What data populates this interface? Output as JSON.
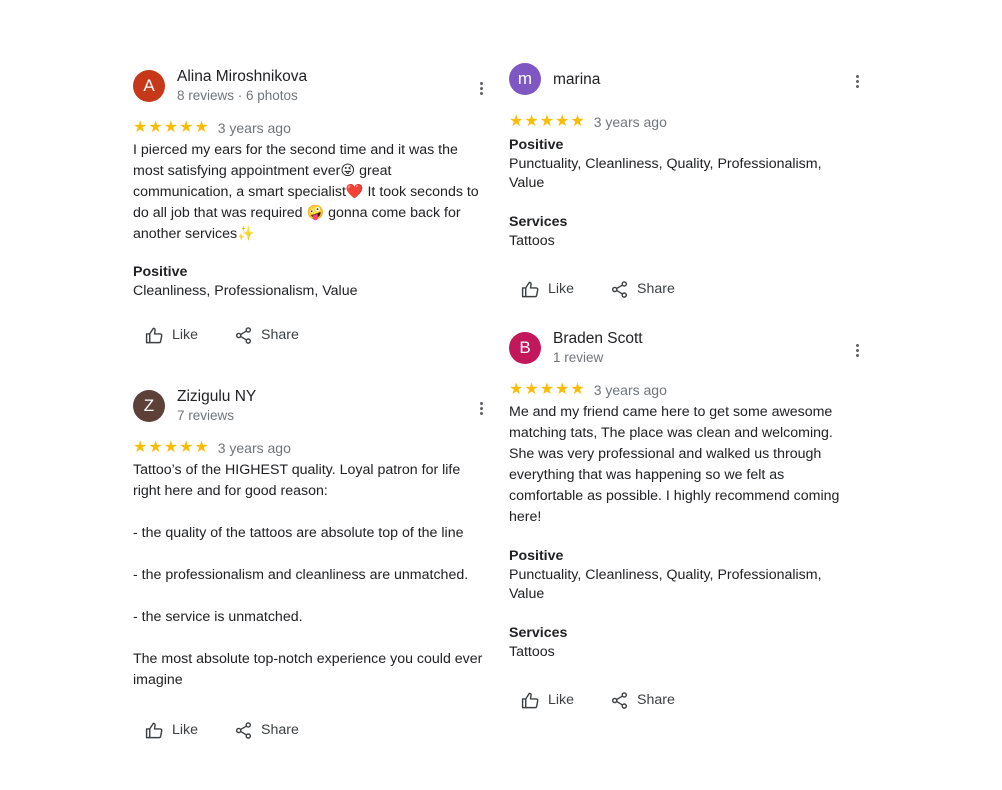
{
  "reviews": [
    {
      "initial": "A",
      "avatar_color": "#c5381a",
      "name": "Alina Miroshnikova",
      "meta": "8 reviews · 6 photos",
      "stars": "★★★★★",
      "time": "3 years ago",
      "text": "I pierced my ears for the second time and it was the most satisfying appointment ever😜 great communication, a smart specialist❤️ It took seconds to do all job that was required 🤪 gonna come back for another services✨",
      "positive_label": "Positive",
      "positive_value": "Cleanliness, Professionalism, Value",
      "like_label": "Like",
      "share_label": "Share"
    },
    {
      "initial": "Z",
      "avatar_color": "#5d4037",
      "name": "Zizigulu NY",
      "meta": "7 reviews",
      "stars": "★★★★★",
      "time": "3 years ago",
      "text": "Tattoo’s of the HIGHEST quality. Loyal patron for life right here and for good reason:\n\n- the quality of the tattoos are absolute top of the line\n\n- the professionalism and cleanliness are unmatched.\n\n- the service is unmatched.\n\nThe most absolute top-notch experience you could ever imagine",
      "like_label": "Like",
      "share_label": "Share"
    },
    {
      "initial": "m",
      "avatar_color": "#7e57c2",
      "name": "marina",
      "stars": "★★★★★",
      "time": "3 years ago",
      "positive_label": "Positive",
      "positive_value": "Punctuality, Cleanliness, Quality, Professionalism, Value",
      "services_label": "Services",
      "services_value": "Tattoos",
      "like_label": "Like",
      "share_label": "Share"
    },
    {
      "initial": "B",
      "avatar_color": "#c2185b",
      "name": "Braden Scott",
      "meta": "1 review",
      "stars": "★★★★★",
      "time": "3 years ago",
      "text": "Me and my friend came here to get some awesome matching tats, The place was clean and welcoming. She was very professional and walked us through everything that was happening so we felt as comfortable as possible. I highly recommend coming here!",
      "positive_label": "Positive",
      "positive_value": "Punctuality, Cleanliness, Quality, Professionalism, Value",
      "services_label": "Services",
      "services_value": "Tattoos",
      "like_label": "Like",
      "share_label": "Share"
    }
  ]
}
